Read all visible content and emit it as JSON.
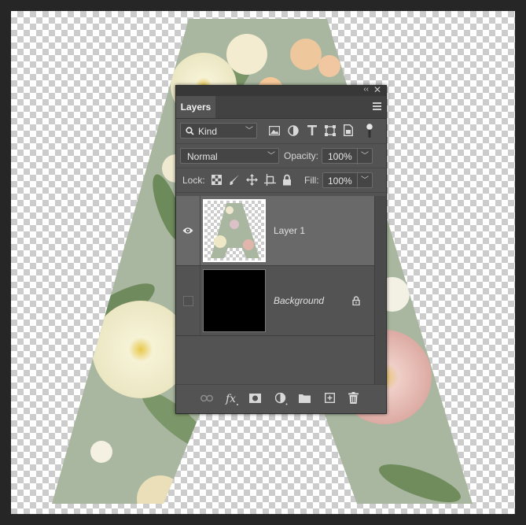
{
  "panel": {
    "tab_label": "Layers",
    "filter": {
      "value": "Kind"
    },
    "blend_mode": {
      "value": "Normal"
    },
    "opacity": {
      "label": "Opacity:",
      "value": "100%"
    },
    "lock": {
      "label": "Lock:"
    },
    "fill": {
      "label": "Fill:",
      "value": "100%"
    }
  },
  "layers": [
    {
      "name": "Layer 1",
      "visible": true,
      "selected": true,
      "locked": false
    },
    {
      "name": "Background",
      "visible": false,
      "selected": false,
      "locked": true
    }
  ],
  "colors": {
    "panel_bg": "#535353",
    "selected_row": "#696969",
    "flower_bg": "#a9b7a0"
  },
  "icons": {
    "filter_icons": [
      "image-filter-icon",
      "adjustment-filter-icon",
      "type-filter-icon",
      "shape-filter-icon",
      "smart-object-filter-icon",
      "filter-toggle-icon"
    ],
    "lock_icons": [
      "lock-transparent-pixels-icon",
      "lock-image-pixels-icon",
      "lock-position-icon",
      "lock-artboard-icon",
      "lock-all-icon"
    ],
    "bottom_icons": [
      "link-layers-icon",
      "fx-icon",
      "add-mask-icon",
      "new-adjustment-icon",
      "new-group-icon",
      "new-layer-icon",
      "delete-layer-icon"
    ]
  }
}
